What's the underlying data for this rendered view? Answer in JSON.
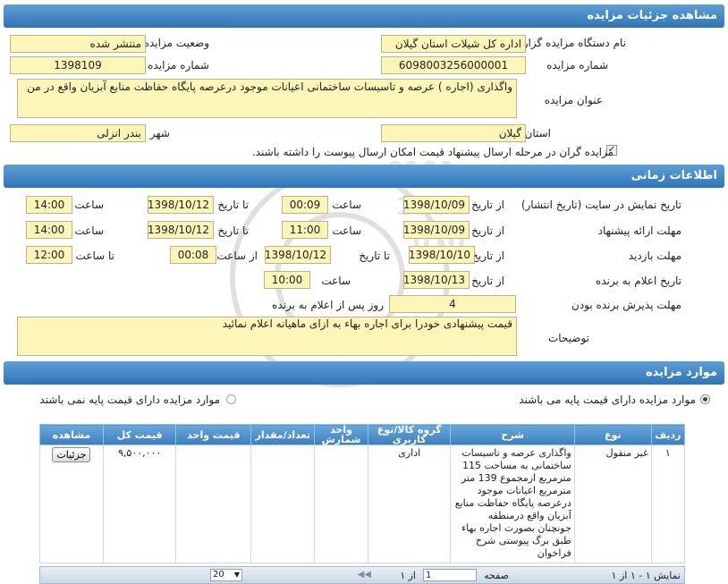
{
  "header": {
    "title": "مشاهده جزئیات مزایده"
  },
  "details": {
    "org_label": "نام دستگاه مزایده گزار",
    "org_value": "اداره کل شیلات استان گیلان",
    "status_label": "وضعیت مزایده",
    "status_value": "منتشر شده",
    "number_label": "شماره مزایده",
    "number_value": "6098003256000001",
    "ref_label": "شماره مزایده مرجع",
    "ref_value": "1398109",
    "subject_label": "عنوان مزایده",
    "subject_value": "واگذاری (اجاره ) عرصه و تاسیسات ساختمانی  اعیانات موجود درعرصه پایگاه حفاظت منابع آبزیان  واقع در من",
    "province_label": "استان",
    "province_value": "گیلان",
    "city_label": "شهر",
    "city_value": "بندر انزلی",
    "checkbox_label": "مزایده گران در مرحله ارسال پیشنهاد قیمت امکان ارسال پیوست را داشته باشند."
  },
  "time_section": {
    "title": "اطلاعات زمانی",
    "display_label": "تاریخ نمایش در سایت (تاریخ انتشار)",
    "offer_label": "مهلت ارائه پیشنهاد",
    "visit_label": "مهلت بازدید",
    "winner_label": "تاریخ اعلام به برنده",
    "accept_label": "مهلت پذیرش برنده بودن",
    "desc_label": "توضیحات",
    "from_date": "از تاریخ",
    "to_date": "تا تاریخ",
    "time": "ساعت",
    "from_time": "از ساعت",
    "to_time": "تا ساعت",
    "display_from": "1398/10/09",
    "display_from_time": "00:09",
    "display_to": "1398/10/12",
    "display_to_time": "14:00",
    "offer_from": "1398/10/09",
    "offer_from_time": "11:00",
    "offer_to": "1398/10/12",
    "offer_to_time": "14:00",
    "visit_from": "1398/10/10",
    "visit_to": "1398/10/12",
    "visit_from_time": "00:08",
    "visit_to_time": "12:00",
    "winner_date": "1398/10/13",
    "winner_time": "10:00",
    "accept_days": "4",
    "accept_suffix": "روز پس از اعلام به برنده",
    "desc_value": "قیمت پیشنهادی خودرا برای اجاره بهاء به ازای ماهیانه اعلام نمائید"
  },
  "items_section": {
    "title": "موارد مزایده",
    "radio_with_base": "موارد مزایده دارای قیمت پایه می باشند",
    "radio_without_base": "موارد مزایده دارای قیمت پایه نمی باشند",
    "columns": [
      "ردیف",
      "نوع",
      "شرح",
      "گروه کالا/نوع کاربری",
      "واحد شمارش",
      "تعداد/مقدار",
      "قیمت واحد",
      "قیمت کل",
      "مشاهده"
    ],
    "rows": [
      {
        "row": "۱",
        "type": "غیر منقول",
        "desc": "واگذاری عرصه و تاسیسات ساختمانی به مساحت 115 مترمربع ازمجموع 139 متر مترمربع اعیانات موجود درعرصه پایگاه حفاظت منابع آبزیان واقع درمنطقه جونچنان بصورت اجاره بهاء طبق برگ پیوستی  شرح فراخوان",
        "group": "اداری",
        "unit": "",
        "qty": "",
        "unit_price": "",
        "total_price": "۹,۵۰۰,۰۰۰",
        "action": "جزئیات"
      }
    ],
    "pager": {
      "page_label": "صفحه",
      "page_value": "1",
      "of_label": "از ۱",
      "page_size": "20",
      "display_info": "نمایش ۱ - ۱ از ۱"
    }
  },
  "colors": {
    "header_bar": "#2f74b5",
    "field_bg": "#fbf5b8",
    "table_header": "#3c7fbd"
  }
}
